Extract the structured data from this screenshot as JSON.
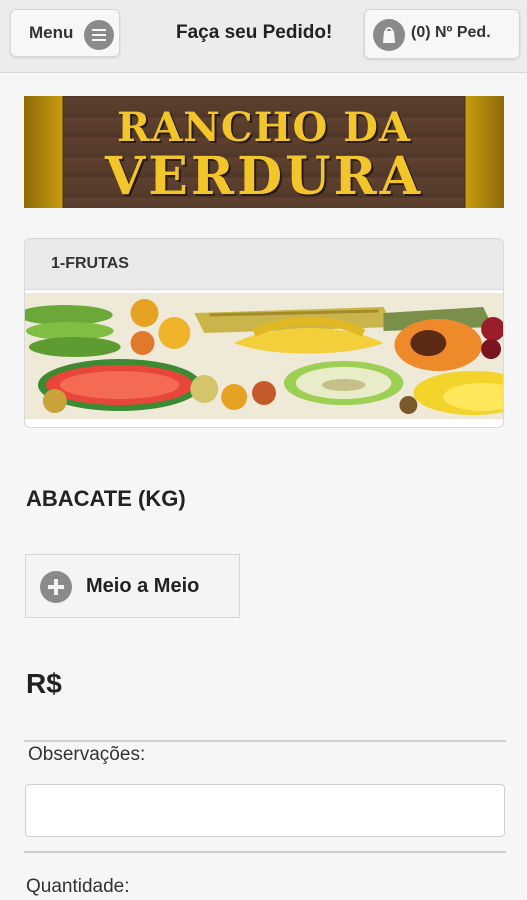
{
  "header": {
    "menu_label": "Menu",
    "title": "Faça seu Pedido!",
    "cart_label": "(0) Nº Ped."
  },
  "banner": {
    "line1": "RANCHO DA",
    "line2": "VERDURA"
  },
  "category": {
    "label": "1-FRUTAS"
  },
  "product": {
    "title": "ABACATE (KG)",
    "half_button_label": "Meio a Meio",
    "price": "R$"
  },
  "form": {
    "observations_label": "Observações:",
    "observations_value": "",
    "quantity_label": "Quantidade:"
  }
}
